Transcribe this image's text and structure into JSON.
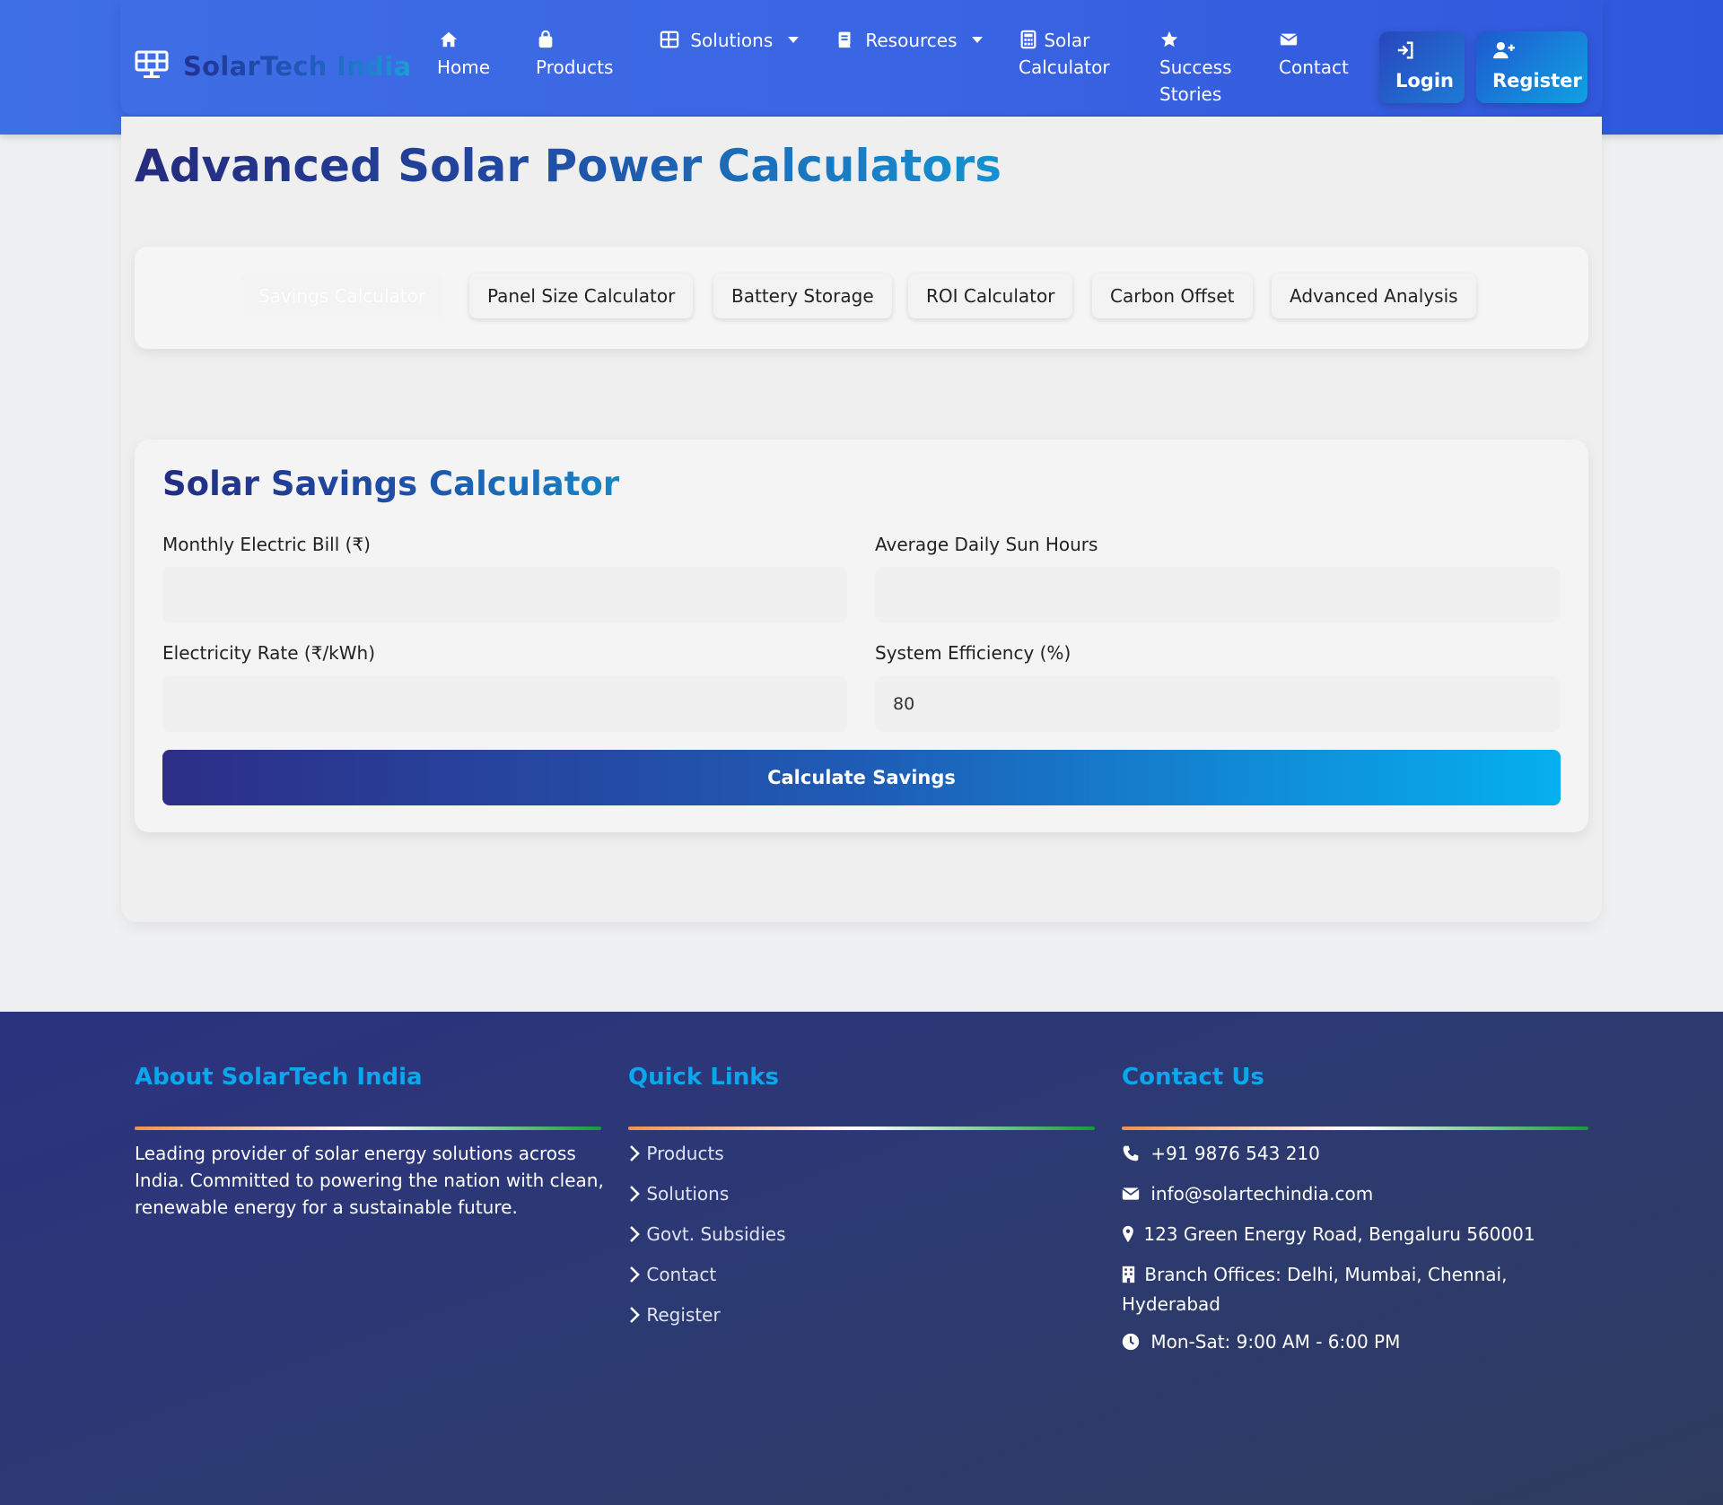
{
  "brand": {
    "name": "SolarTech India"
  },
  "nav": {
    "items": [
      {
        "label": "Home",
        "icon": "home-icon"
      },
      {
        "label": "Products",
        "icon": "shopping-bag-icon"
      },
      {
        "label": "Solutions",
        "icon": "grid-icon",
        "dropdown": true
      },
      {
        "label": "Resources",
        "icon": "book-icon",
        "dropdown": true
      },
      {
        "label_line1": "Solar",
        "label_line2": "Calculator",
        "icon": "calculator-icon"
      },
      {
        "label_line1": "Success",
        "label_line2": "Stories",
        "icon": "star-icon"
      },
      {
        "label": "Contact",
        "icon": "envelope-icon"
      }
    ],
    "login": "Login",
    "register": "Register"
  },
  "page": {
    "title": "Advanced Solar Power Calculators"
  },
  "tabs": [
    {
      "label": "Savings Calculator",
      "active": true
    },
    {
      "label": "Panel Size Calculator"
    },
    {
      "label": "Battery Storage"
    },
    {
      "label": "ROI Calculator"
    },
    {
      "label": "Carbon Offset"
    },
    {
      "label": "Advanced Analysis"
    }
  ],
  "calculator": {
    "title": "Solar Savings Calculator",
    "fields": {
      "monthly_bill": {
        "label": "Monthly Electric Bill (₹)",
        "value": ""
      },
      "sun_hours": {
        "label": "Average Daily Sun Hours",
        "value": ""
      },
      "rate": {
        "label": "Electricity Rate (₹/kWh)",
        "value": ""
      },
      "efficiency": {
        "label": "System Efficiency (%)",
        "value": "80"
      }
    },
    "button": "Calculate Savings"
  },
  "footer": {
    "about": {
      "heading": "About SolarTech India",
      "text": "Leading provider of solar energy solutions across India. Committed to powering the nation with clean, renewable energy for a sustainable future."
    },
    "links": {
      "heading": "Quick Links",
      "items": [
        "Products",
        "Solutions",
        "Govt. Subsidies",
        "Contact",
        "Register"
      ]
    },
    "contact": {
      "heading": "Contact Us",
      "phone": "+91 9876 543 210",
      "email": "info@solartechindia.com",
      "address": "123 Green Energy Road, Bengaluru 560001",
      "branches": "Branch Offices: Delhi, Mumbai, Chennai, Hyderabad",
      "hours": "Mon-Sat: 9:00 AM - 6:00 PM"
    }
  },
  "colors": {
    "nav_bg": "#3a65e3",
    "accent": "#0aa7ee",
    "footer_bg": "#2c3a72"
  }
}
